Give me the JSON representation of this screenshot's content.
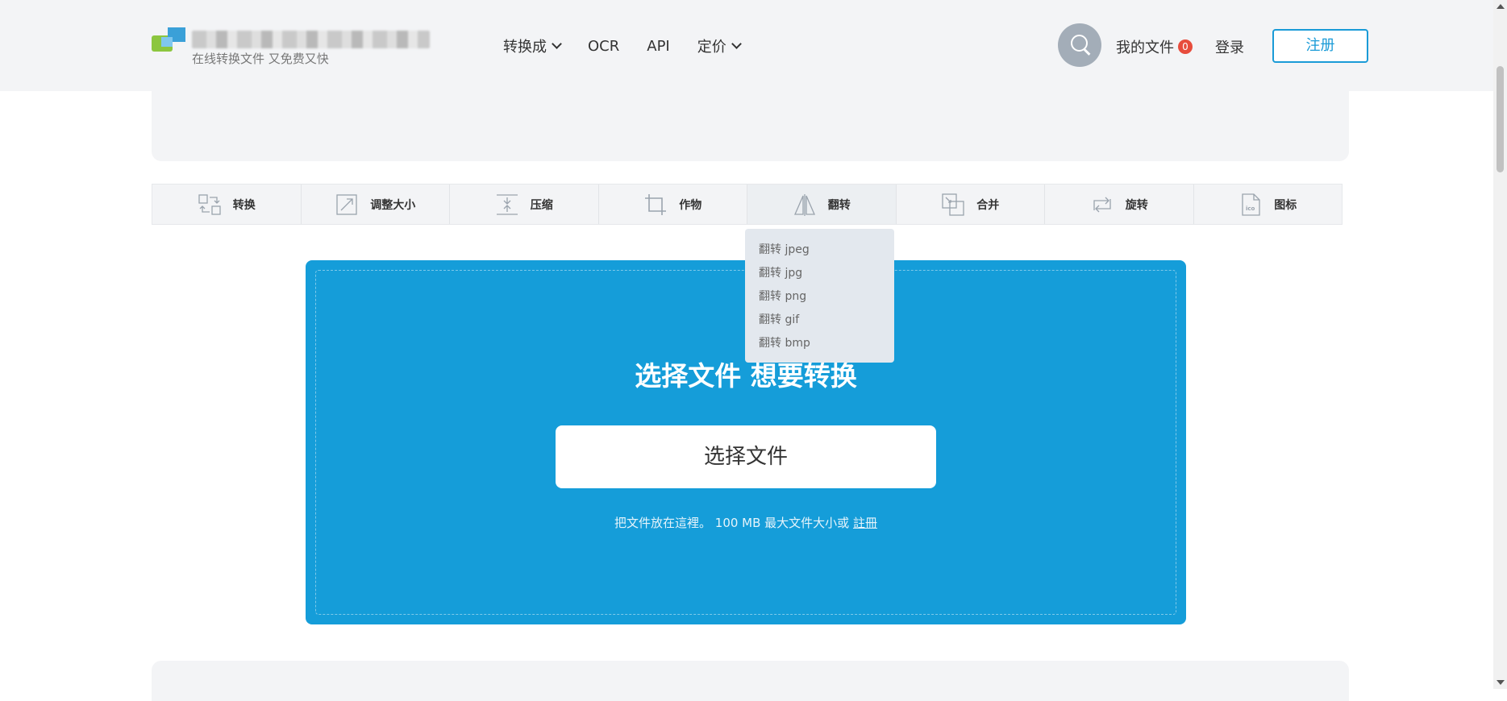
{
  "header": {
    "logo_tagline": "在线转换文件 又免费又快",
    "nav": [
      {
        "label": "转换成",
        "has_dropdown": true
      },
      {
        "label": "OCR",
        "has_dropdown": false
      },
      {
        "label": "API",
        "has_dropdown": false
      },
      {
        "label": "定价",
        "has_dropdown": true
      }
    ],
    "my_files_label": "我的文件",
    "my_files_count": "0",
    "login_label": "登录",
    "signup_label": "注册"
  },
  "tools": [
    {
      "label": "转换",
      "icon": "convert-icon"
    },
    {
      "label": "调整大小",
      "icon": "resize-icon"
    },
    {
      "label": "压缩",
      "icon": "compress-icon"
    },
    {
      "label": "作物",
      "icon": "crop-icon"
    },
    {
      "label": "翻转",
      "icon": "flip-icon"
    },
    {
      "label": "合并",
      "icon": "merge-icon"
    },
    {
      "label": "旋转",
      "icon": "rotate-icon"
    },
    {
      "label": "图标",
      "icon": "ico-icon"
    }
  ],
  "flip_dropdown": [
    "翻转 jpeg",
    "翻转 jpg",
    "翻转 png",
    "翻转 gif",
    "翻转 bmp"
  ],
  "upload": {
    "title": "选择文件 想要转换",
    "choose_button": "选择文件",
    "hint_prefix": "把文件放在這裡。 100 MB 最大文件大小或",
    "hint_link": "註冊"
  },
  "colors": {
    "accent": "#1a9bd7",
    "upload_bg": "#159dd9",
    "header_bg": "#f3f4f6",
    "badge": "#e74c3c"
  }
}
